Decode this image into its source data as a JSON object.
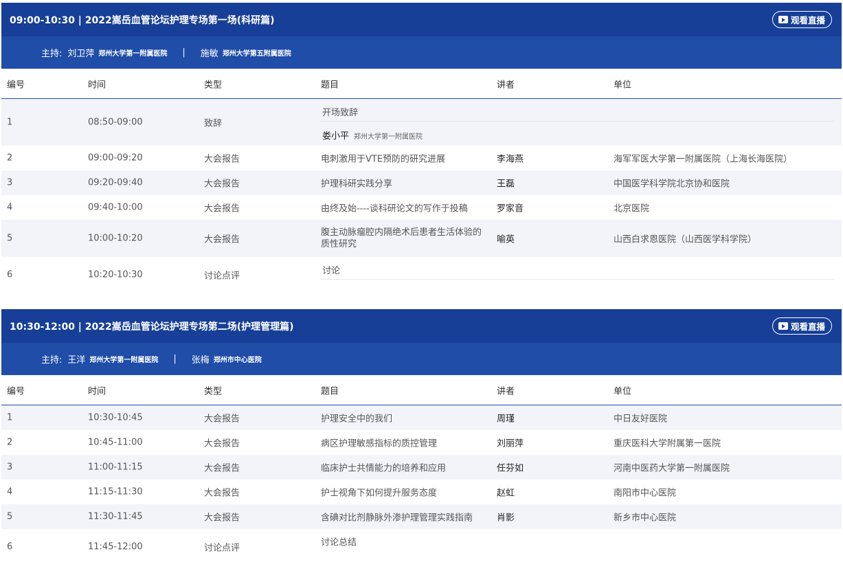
{
  "sessions": [
    {
      "title": "09:00-10:30 | 2022嵩岳血管论坛护理专场第一场(科研篇)",
      "watch_label": "观看直播",
      "host_label": "主持:",
      "hosts": [
        {
          "name": "刘卫萍",
          "unit": "郑州大学第一附属医院"
        },
        {
          "name": "施敏",
          "unit": "郑州大学第五附属医院"
        }
      ],
      "host_sep": "|",
      "headers": [
        "编号",
        "时间",
        "类型",
        "题目",
        "讲者",
        "单位"
      ],
      "rows": [
        {
          "no": "1",
          "time": "08:50-09:00",
          "type": "致辞",
          "topic": "开场致辞",
          "speaker": "娄小平",
          "speaker_unit": "郑州大学第一附属医院",
          "unit": ""
        },
        {
          "no": "2",
          "time": "09:00-09:20",
          "type": "大会报告",
          "topic": "电刺激用于VTE预防的研究进展",
          "speaker": "李海燕",
          "unit": "海军军医大学第一附属医院（上海长海医院）"
        },
        {
          "no": "3",
          "time": "09:20-09:40",
          "type": "大会报告",
          "topic": "护理科研实践分享",
          "speaker": "王磊",
          "unit": "中国医学科学院北京协和医院"
        },
        {
          "no": "4",
          "time": "09:40-10:00",
          "type": "大会报告",
          "topic": "由终及始----谈科研论文的写作于投稿",
          "speaker": "罗家音",
          "unit": "北京医院"
        },
        {
          "no": "5",
          "time": "10:00-10:20",
          "type": "大会报告",
          "topic": "腹主动脉瘤腔内隔绝术后患者生活体验的质性研究",
          "speaker": "喻英",
          "unit": "山西白求恩医院（山西医学科学院）"
        },
        {
          "no": "6",
          "time": "10:20-10:30",
          "type": "讨论点评",
          "topic": "讨论",
          "speaker": "",
          "unit": ""
        }
      ]
    },
    {
      "title": "10:30-12:00 | 2022嵩岳血管论坛护理专场第二场(护理管理篇)",
      "watch_label": "观看直播",
      "host_label": "主持:",
      "hosts": [
        {
          "name": "王洋",
          "unit": "郑州大学第一附属医院"
        },
        {
          "name": "张梅",
          "unit": "郑州市中心医院"
        }
      ],
      "host_sep": "|",
      "headers": [
        "编号",
        "时间",
        "类型",
        "题目",
        "讲者",
        "单位"
      ],
      "rows": [
        {
          "no": "1",
          "time": "10:30-10:45",
          "type": "大会报告",
          "topic": "护理安全中的我们",
          "speaker": "周瑾",
          "unit": "中日友好医院"
        },
        {
          "no": "2",
          "time": "10:45-11:00",
          "type": "大会报告",
          "topic": "病区护理敏感指标的质控管理",
          "speaker": "刘丽萍",
          "unit": "重庆医科大学附属第一医院"
        },
        {
          "no": "3",
          "time": "11:00-11:15",
          "type": "大会报告",
          "topic": "临床护士共情能力的培养和应用",
          "speaker": "任芬如",
          "unit": "河南中医药大学第一附属医院"
        },
        {
          "no": "4",
          "time": "11:15-11:30",
          "type": "大会报告",
          "topic": "护士视角下如何提升服务态度",
          "speaker": "赵虹",
          "unit": "南阳市中心医院"
        },
        {
          "no": "5",
          "time": "11:30-11:45",
          "type": "大会报告",
          "topic": "含碘对比剂静脉外渗护理管理实践指南",
          "speaker": "肖影",
          "unit": "新乡市中心医院"
        },
        {
          "no": "6",
          "time": "11:45-12:00",
          "type": "讨论点评",
          "topic": "讨论总结",
          "speaker": "",
          "unit": ""
        }
      ]
    }
  ],
  "colors": {
    "header_bg": "#173f97",
    "host_bg": "#1f4da8",
    "row_alt": "#f2f4f9"
  },
  "icons": {
    "watch": "play-icon"
  }
}
